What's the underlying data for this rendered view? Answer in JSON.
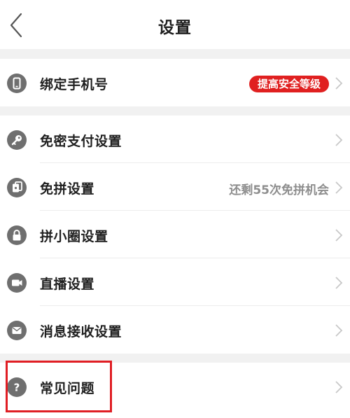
{
  "header": {
    "title": "设置",
    "back_icon": "chevron-left-icon"
  },
  "sections": [
    {
      "items": [
        {
          "icon": "phone-icon",
          "label": "绑定手机号",
          "badge": "提高安全等级",
          "badge_color": "#e02020"
        }
      ]
    },
    {
      "items": [
        {
          "icon": "key-icon",
          "label": "免密支付设置"
        },
        {
          "icon": "cards-icon",
          "label": "免拼设置",
          "secondary": "还剩55次免拼机会"
        },
        {
          "icon": "lock-icon",
          "label": "拼小圈设置"
        },
        {
          "icon": "video-camera-icon",
          "label": "直播设置"
        },
        {
          "icon": "mail-icon",
          "label": "消息接收设置"
        }
      ]
    },
    {
      "items": [
        {
          "icon": "question-icon",
          "label": "常见问题",
          "highlighted": true,
          "highlight_color": "#e01e24"
        }
      ]
    }
  ],
  "colors": {
    "accent": "#e02020",
    "icon_gray": "#6f6f6f",
    "separator": "#f1f1f1"
  }
}
